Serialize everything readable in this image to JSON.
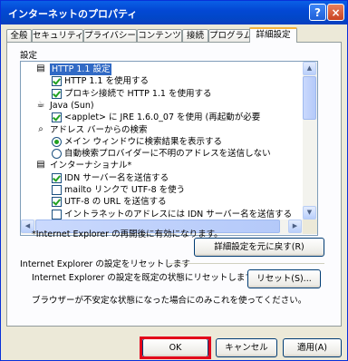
{
  "window": {
    "title": "インターネットのプロパティ",
    "help_icon": "?",
    "close_icon": "×"
  },
  "tabs": [
    "全般",
    "セキュリティ",
    "プライバシー",
    "コンテンツ",
    "接続",
    "プログラム",
    "詳細設定"
  ],
  "active_tab": "詳細設定",
  "settings_label": "設定",
  "settings_list": [
    {
      "kind": "group",
      "icon": "page-icon",
      "text": "HTTP 1.1 設定",
      "selected": true
    },
    {
      "kind": "checkbox",
      "checked": true,
      "text": "HTTP 1.1 を使用する"
    },
    {
      "kind": "checkbox",
      "checked": true,
      "text": "プロキシ接続で HTTP 1.1 を使用する"
    },
    {
      "kind": "group",
      "icon": "java-icon",
      "text": "Java (Sun)"
    },
    {
      "kind": "checkbox",
      "checked": true,
      "text": "<applet> に JRE 1.6.0_07 を使用 (再起動が必要"
    },
    {
      "kind": "group",
      "icon": "search-icon",
      "text": "アドレス バーからの検索"
    },
    {
      "kind": "radio",
      "checked": true,
      "text": "メイン ウィンドウに検索結果を表示する"
    },
    {
      "kind": "radio",
      "checked": false,
      "text": "自動検索プロバイダーに不明のアドレスを送信しない"
    },
    {
      "kind": "group",
      "icon": "page-icon",
      "text": "インターナショナル*"
    },
    {
      "kind": "checkbox",
      "checked": true,
      "text": "IDN サーバー名を送信する"
    },
    {
      "kind": "checkbox",
      "checked": false,
      "text": "mailto リンクで UTF-8 を使う"
    },
    {
      "kind": "checkbox",
      "checked": true,
      "text": "UTF-8 の URL を送信する"
    },
    {
      "kind": "checkbox",
      "checked": false,
      "text": "イントラネットのアドレスには IDN サーバー名を送信する"
    }
  ],
  "restart_note": "*Internet Explorer の再開後に有効になります。",
  "restore_button": "詳細設定を元に戻す(R)",
  "reset_group_label": "Internet Explorer の設定をリセットします",
  "reset_desc": "Internet Explorer の設定を既定の状態にリセットします。",
  "reset_button": "リセット(S)...",
  "reset_hint": "ブラウザーが不安定な状態になった場合にのみこれを使ってください。",
  "footer": {
    "ok": "OK",
    "cancel": "キャンセル",
    "apply": "適用(A)"
  },
  "colors": {
    "title_bar": "#0348d4",
    "selection": "#316ac5",
    "highlight_box": "#e3001b",
    "active_tab_accent": "#f8b33b"
  }
}
